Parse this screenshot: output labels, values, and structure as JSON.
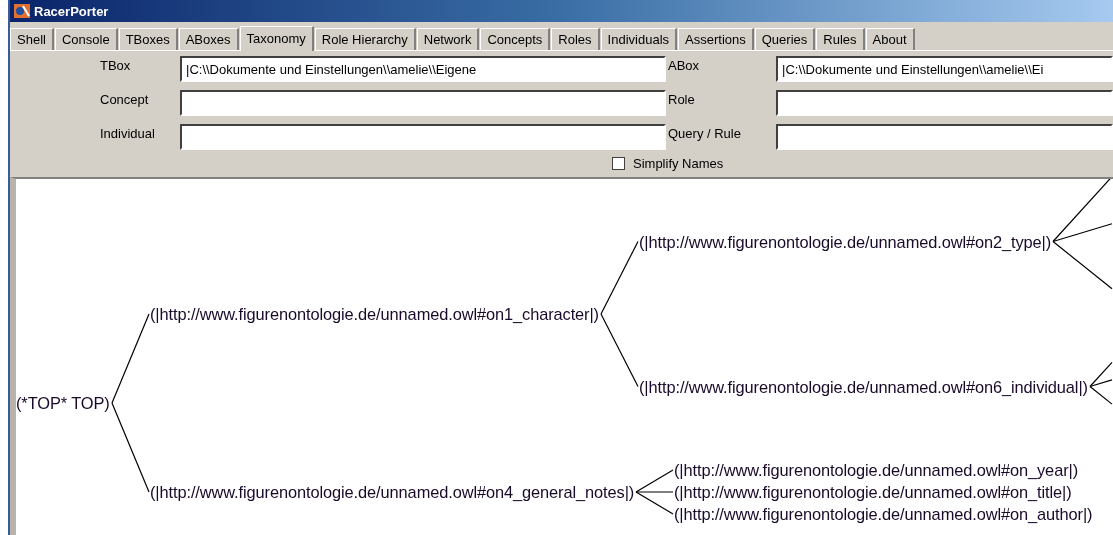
{
  "window": {
    "title": "RacerPorter"
  },
  "tabs": [
    {
      "label": "Shell",
      "selected": false
    },
    {
      "label": "Console",
      "selected": false
    },
    {
      "label": "TBoxes",
      "selected": false
    },
    {
      "label": "ABoxes",
      "selected": false
    },
    {
      "label": "Taxonomy",
      "selected": true
    },
    {
      "label": "Role Hierarchy",
      "selected": false
    },
    {
      "label": "Network",
      "selected": false
    },
    {
      "label": "Concepts",
      "selected": false
    },
    {
      "label": "Roles",
      "selected": false
    },
    {
      "label": "Individuals",
      "selected": false
    },
    {
      "label": "Assertions",
      "selected": false
    },
    {
      "label": "Queries",
      "selected": false
    },
    {
      "label": "Rules",
      "selected": false
    },
    {
      "label": "About",
      "selected": false
    }
  ],
  "fields": [
    {
      "label": "TBox",
      "value": "|C:\\\\Dokumente und Einstellungen\\\\amelie\\\\Eigene"
    },
    {
      "label": "ABox",
      "value": "|C:\\\\Dokumente und Einstellungen\\\\amelie\\\\Ei"
    },
    {
      "label": "Concept"
    },
    {
      "label": "Role"
    },
    {
      "label": "Individual"
    },
    {
      "label": "Query / Rule"
    }
  ],
  "simplify_names": {
    "label": "Simplify Names",
    "checked": false
  },
  "taxonomy": {
    "label": "(*TOP* TOP)",
    "children": [
      {
        "label": "(|http://www.figurenontologie.de/unnamed.owl#on1_character|)",
        "children": [
          {
            "label": "(|http://www.figurenontologie.de/unnamed.owl#on2_type|)",
            "continues": true
          },
          {
            "label": "(|http://www.figurenontologie.de/unnamed.owl#on6_individual|)",
            "continues": true
          }
        ]
      },
      {
        "label": "(|http://www.figurenontologie.de/unnamed.owl#on4_general_notes|)",
        "children": [
          {
            "label": "(|http://www.figurenontologie.de/unnamed.owl#on_year|)"
          },
          {
            "label": "(|http://www.figurenontologie.de/unnamed.owl#on_title|)"
          },
          {
            "label": "(|http://www.figurenontologie.de/unnamed.owl#on_author|)"
          }
        ]
      }
    ]
  }
}
